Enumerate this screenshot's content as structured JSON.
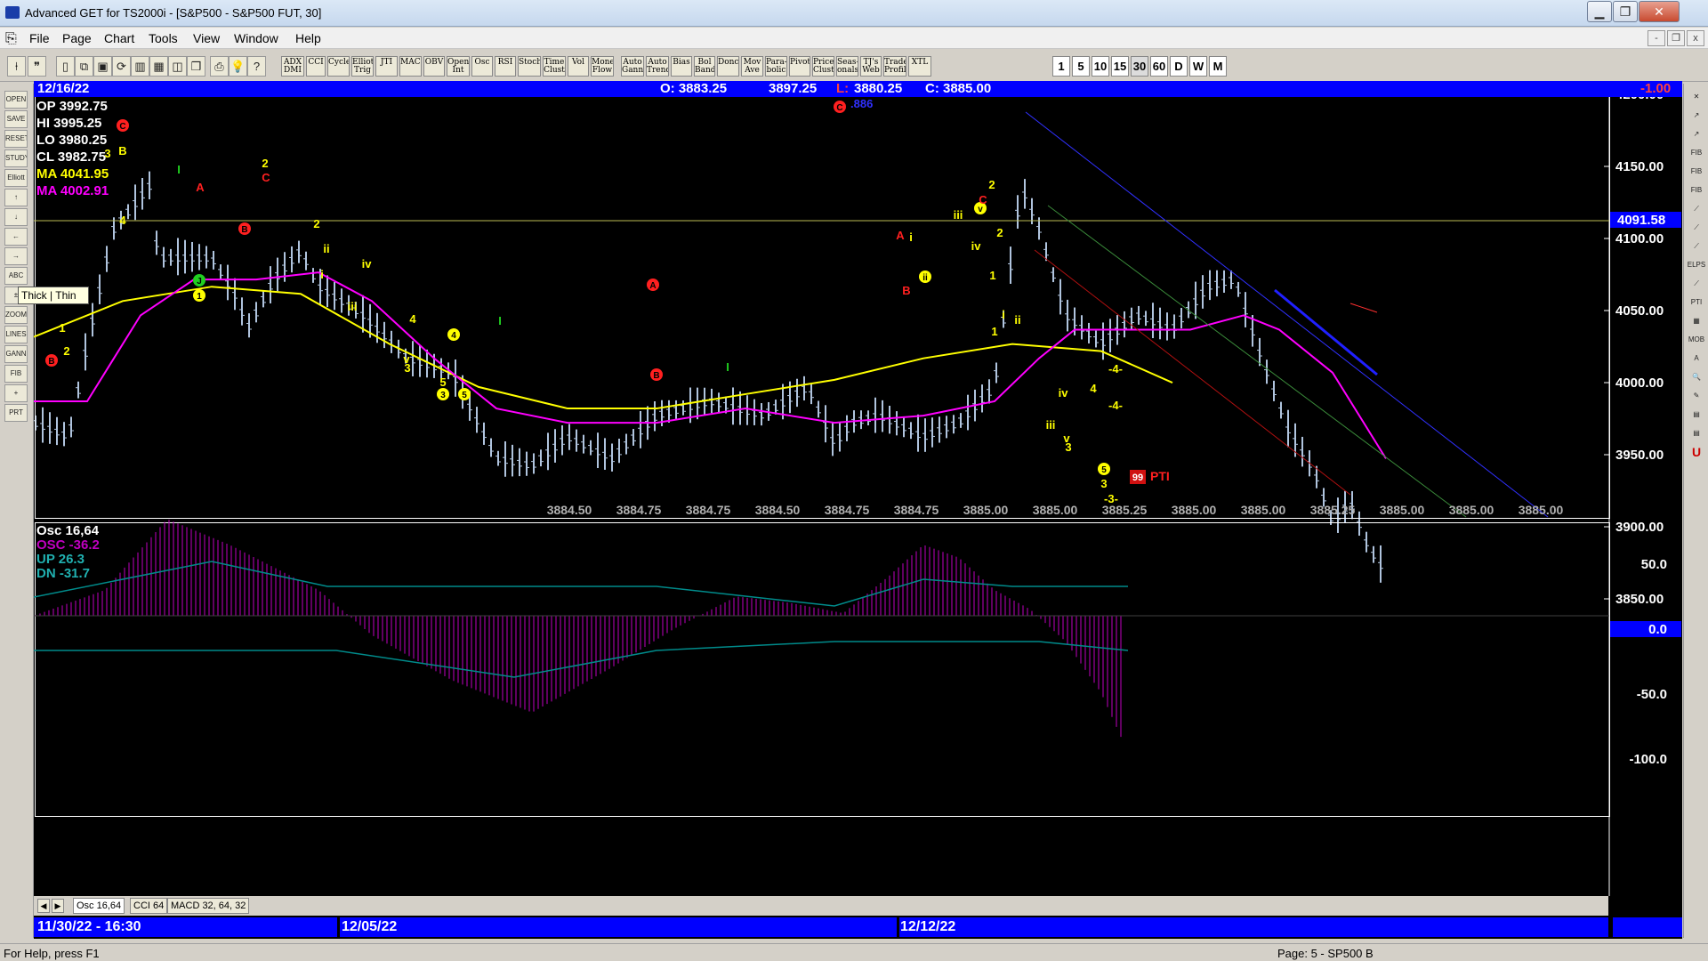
{
  "window": {
    "title": "Advanced GET for TS2000i - [S&P500 - S&P500 FUT, 30]",
    "minimize_label": "▁",
    "maximize_label": "❐",
    "close_label": "✕"
  },
  "menu": {
    "items": [
      "File",
      "Page",
      "Chart",
      "Tools",
      "View",
      "Window",
      "Help"
    ],
    "mdi_minimize": "-",
    "mdi_restore": "❐",
    "mdi_close": "x"
  },
  "toolbar": {
    "studies": [
      "ADX DMI",
      "CCI",
      "Cycles",
      "Elliott Trig",
      "JTI",
      "MACD",
      "OBV",
      "Open Int",
      "Osc",
      "RSI",
      "Stoch",
      "Time Clust",
      "Vol",
      "Money Flow",
      "Auto Gann",
      "Auto Trend",
      "Bias",
      "Bol Band",
      "Donch",
      "Mov Ave",
      "Para-bolic",
      "Pivot",
      "Price Clust",
      "Seas-onals",
      "TJ's Web",
      "Trade Profile",
      "XTL"
    ],
    "timeframes": [
      "1",
      "5",
      "10",
      "15",
      "30",
      "60",
      "D",
      "W",
      "M"
    ],
    "selected_timeframe": "30"
  },
  "left_tools": [
    "OPEN",
    "SAVE",
    "RESET",
    "STUDY",
    "Elliott",
    "↑",
    "↓",
    "←",
    "→",
    "ABC",
    "±",
    "ZOOM",
    "LINES",
    "GANN",
    "FIB",
    "+",
    "PRT"
  ],
  "right_tools": [
    "✕",
    "↗",
    "↗",
    "FIB RET",
    "FIB EXT",
    "FIB TIME",
    "⟋",
    "⟋",
    "⟋",
    "ELPS",
    "⟋",
    "PTI",
    "▦",
    "MOB",
    "A",
    "🔍",
    "✎",
    "▤",
    "▤",
    "U"
  ],
  "tooltip": "Thick | Thin",
  "chart": {
    "infobar": {
      "date": "12/16/22",
      "open": "O: 3883.25",
      "high": "3897.25",
      "low_label": "L:",
      "low": "3880.25",
      "close": "C: 3885.00",
      "change": "-1.00"
    },
    "readout": {
      "op": "OP  3992.75",
      "hi": "HI   3995.25",
      "lo": "LO   3980.25",
      "cl": "CL   3982.75",
      "ma1": "MA  4041.95",
      "ma2": "MA  4002.91"
    },
    "price_ticks": [
      "4200.00",
      "4150.00",
      "4100.00",
      "4050.00",
      "4000.00",
      "3950.00",
      "3900.00",
      "3850.00"
    ],
    "price_line_label": "4091.58",
    "bottom_values": [
      "3884.50",
      "3884.75",
      "3884.75",
      "3884.50",
      "3884.75",
      "3884.75",
      "3885.00",
      "3885.00",
      "3885.25",
      "3885.00",
      "3885.00",
      "3885.25",
      "3885.00",
      "3885.00",
      "3885.00"
    ],
    "fib_label": ".886",
    "pti_value": "99",
    "pti_label": "PTI",
    "osc_readout": {
      "osc": "Osc 16,64",
      "osc2": "OSC -36.2",
      "up": "UP   26.3",
      "dn": "DN   -31.7"
    },
    "osc_ticks": [
      "50.0",
      "0.0",
      "-50.0",
      "-100.0"
    ],
    "wave_labels": [
      {
        "t": "B",
        "c": "r"
      },
      {
        "t": "1",
        "c": "y"
      },
      {
        "t": "2",
        "c": "y"
      },
      {
        "t": "3",
        "c": "y"
      },
      {
        "t": "B",
        "c": "y"
      },
      {
        "t": "C",
        "c": "r"
      },
      {
        "t": "4",
        "c": "y"
      },
      {
        "t": "I",
        "c": "g"
      },
      {
        "t": "A",
        "c": "r"
      },
      {
        "t": "J",
        "c": "g"
      },
      {
        "t": "1",
        "c": "y"
      },
      {
        "t": "B",
        "c": "r"
      },
      {
        "t": "2",
        "c": "y"
      },
      {
        "t": "C",
        "c": "r"
      },
      {
        "t": "2",
        "c": "y"
      },
      {
        "t": "ii",
        "c": "y"
      },
      {
        "t": "i",
        "c": "y"
      },
      {
        "t": "iv",
        "c": "y"
      },
      {
        "t": "iii",
        "c": "y"
      },
      {
        "t": "4",
        "c": "y"
      },
      {
        "t": "v",
        "c": "y"
      },
      {
        "t": "3",
        "c": "y"
      },
      {
        "t": "4",
        "c": "y"
      },
      {
        "t": "5",
        "c": "y"
      },
      {
        "t": "3",
        "c": "y"
      },
      {
        "t": "5",
        "c": "y"
      },
      {
        "t": "I",
        "c": "g"
      },
      {
        "t": "A",
        "c": "r"
      },
      {
        "t": "B",
        "c": "r"
      },
      {
        "t": "I",
        "c": "g"
      },
      {
        "t": "C",
        "c": "r"
      },
      {
        "t": "A",
        "c": "r"
      },
      {
        "t": "i",
        "c": "y"
      },
      {
        "t": "B",
        "c": "r"
      },
      {
        "t": "ii",
        "c": "y"
      },
      {
        "t": "1",
        "c": "y"
      },
      {
        "t": "iii",
        "c": "y"
      },
      {
        "t": "iv",
        "c": "y"
      },
      {
        "t": "v",
        "c": "y"
      },
      {
        "t": "2",
        "c": "y"
      },
      {
        "t": "C",
        "c": "r"
      },
      {
        "t": "2",
        "c": "y"
      },
      {
        "t": "1",
        "c": "y"
      },
      {
        "t": "i",
        "c": "y"
      },
      {
        "t": "ii",
        "c": "y"
      },
      {
        "t": "iii",
        "c": "y"
      },
      {
        "t": "iv",
        "c": "y"
      },
      {
        "t": "v",
        "c": "y"
      },
      {
        "t": "3",
        "c": "y"
      },
      {
        "t": "4",
        "c": "y"
      },
      {
        "t": "5",
        "c": "y"
      },
      {
        "t": "3",
        "c": "y"
      },
      {
        "t": "-4-",
        "c": "y"
      },
      {
        "t": "-4-",
        "c": "y"
      },
      {
        "t": "-3-",
        "c": "y"
      }
    ]
  },
  "tabs": [
    "Osc 16,64",
    "CCI 64",
    "MACD 32, 64, 32"
  ],
  "dates": [
    "11/30/22 - 16:30",
    "12/05/22",
    "12/12/22"
  ],
  "status": {
    "help": "For Help, press F1",
    "page": "Page: 5 - SP500 B"
  },
  "colors": {
    "background": "#000000",
    "infobar": "#0000ff",
    "ma_yellow": "#ffff00",
    "ma_magenta": "#ff00ff",
    "bars": "#b0c4de",
    "osc_hist": "#c000c0",
    "band": "#008b8b"
  }
}
